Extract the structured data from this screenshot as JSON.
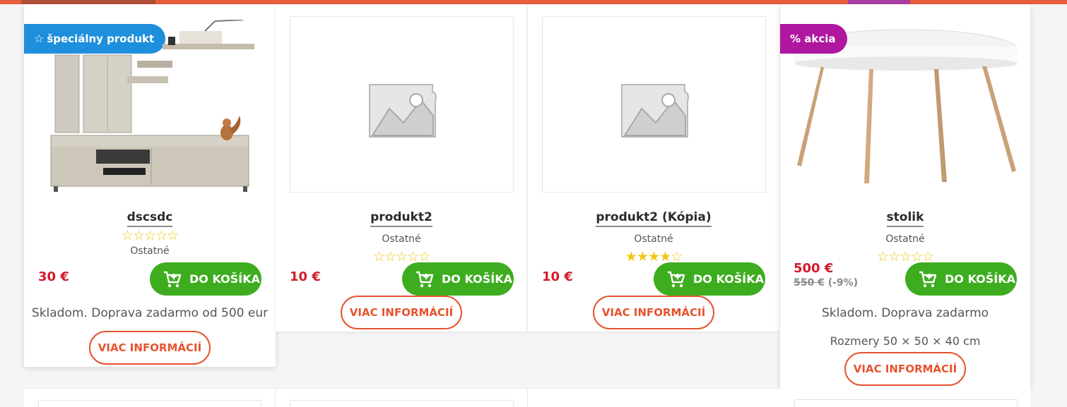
{
  "colors": {
    "accent": "#e95f3b",
    "cart_green": "#3dad1f",
    "price_red": "#d21a2b",
    "special_blue": "#1e8fdc",
    "sale_purple": "#b0179f"
  },
  "products": [
    {
      "badge": "špeciálny produkt",
      "badge_icon": "star-outline-icon",
      "image": "tv-wall-unit-photo",
      "title": "dscsdc",
      "category": "Ostatné",
      "rating": 0,
      "price": "30 €",
      "cart_label": "DO KOŠÍKA",
      "availability": "Skladom. Doprava zadarmo od 500 eur",
      "info_label": "VIAC INFORMÁCIÍ"
    },
    {
      "image": "placeholder-image-icon",
      "title": "produkt2",
      "category": "Ostatné",
      "rating": 0,
      "price": "10 €",
      "cart_label": "DO KOŠÍKA",
      "info_label": "VIAC INFORMÁCIÍ"
    },
    {
      "image": "placeholder-image-icon",
      "title": "produkt2 (Kópia)",
      "category": "Ostatné",
      "rating": 4,
      "price": "10 €",
      "cart_label": "DO KOŠÍKA",
      "info_label": "VIAC INFORMÁCIÍ"
    },
    {
      "badge": "% akcia",
      "image": "round-table-photo",
      "title": "stolik",
      "category": "Ostatné",
      "rating": 0,
      "price": "500 €",
      "old_price": "550 €",
      "discount": "(-9%)",
      "cart_label": "DO KOŠÍKA",
      "availability": "Skladom. Doprava zadarmo",
      "dimensions": "Rozmery 50 × 50 × 40 cm",
      "info_label": "VIAC INFORMÁCIÍ"
    }
  ]
}
